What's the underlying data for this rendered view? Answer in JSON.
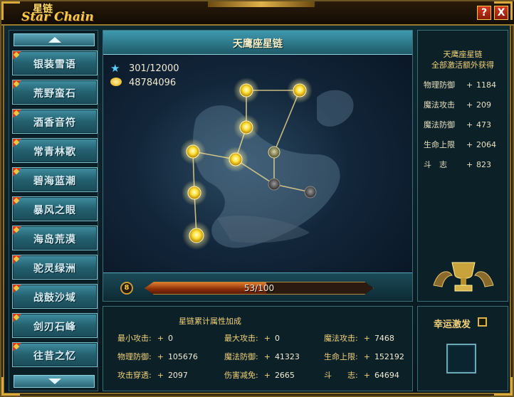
{
  "window": {
    "title_cn": "星链",
    "title_en": "Star Chain",
    "help_button": "?",
    "close_button": "X"
  },
  "sidebar": {
    "items": [
      {
        "label": "银装雪语"
      },
      {
        "label": "荒野蛮石"
      },
      {
        "label": "酒香音符"
      },
      {
        "label": "常青林歌"
      },
      {
        "label": "碧海蓝潮"
      },
      {
        "label": "暴风之眼"
      },
      {
        "label": "海岛荒漠"
      },
      {
        "label": "驼灵绿洲"
      },
      {
        "label": "战鼓沙域"
      },
      {
        "label": "剑刃石峰"
      },
      {
        "label": "往昔之忆"
      }
    ]
  },
  "constellation": {
    "title": "天鹰座星链",
    "stars_text": "301/12000",
    "gold_text": "48784096",
    "level": "8",
    "progress_text": "53/100",
    "progress_fraction": 0.53,
    "star_icon": "star-icon",
    "gold_icon": "gold-coin-icon",
    "star_nodes_lit": 8,
    "star_nodes_dim": 3
  },
  "bonus": {
    "title_line1": "天鹰座星链",
    "title_line2": "全部激活额外获得",
    "rows": [
      {
        "key": "物理防御",
        "plus": "+",
        "value": "1184"
      },
      {
        "key": "魔法攻击",
        "plus": "+",
        "value": "209"
      },
      {
        "key": "魔法防御",
        "plus": "+",
        "value": "473"
      },
      {
        "key": "生命上限",
        "plus": "+",
        "value": "2064"
      },
      {
        "key": "斗　志",
        "plus": "+",
        "value": "823"
      }
    ],
    "trophy_icon": "trophy-icon"
  },
  "stats": {
    "title": "星链累计属性加成",
    "rows": [
      [
        {
          "key": "最小攻击:",
          "plus": "+",
          "value": "0"
        },
        {
          "key": "最大攻击:",
          "plus": "+",
          "value": "0"
        },
        {
          "key": "魔法攻击:",
          "plus": "+",
          "value": "7468"
        }
      ],
      [
        {
          "key": "物理防御:",
          "plus": "+",
          "value": "105676"
        },
        {
          "key": "魔法防御:",
          "plus": "+",
          "value": "41323"
        },
        {
          "key": "生命上限:",
          "plus": "+",
          "value": "152192"
        }
      ],
      [
        {
          "key": "攻击穿透:",
          "plus": "+",
          "value": "2097"
        },
        {
          "key": "伤害减免:",
          "plus": "+",
          "value": "2665"
        },
        {
          "key": "斗　　志:",
          "plus": "+",
          "value": "64694"
        }
      ]
    ]
  },
  "lucky": {
    "label": "幸运激发",
    "checked": false
  },
  "colors": {
    "accent_gold": "#f2d27a",
    "panel_teal": "#3f8ea0",
    "lit_star": "#ffe23a",
    "dim_star": "#5a5a5a"
  }
}
